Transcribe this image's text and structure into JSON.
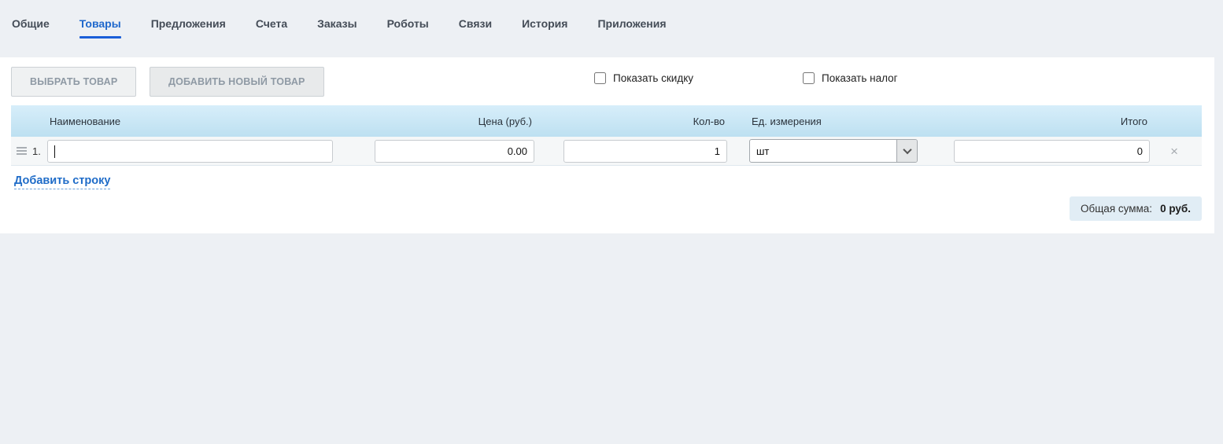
{
  "tabs": [
    {
      "label": "Общие",
      "active": false
    },
    {
      "label": "Товары",
      "active": true
    },
    {
      "label": "Предложения",
      "active": false
    },
    {
      "label": "Счета",
      "active": false
    },
    {
      "label": "Заказы",
      "active": false
    },
    {
      "label": "Роботы",
      "active": false
    },
    {
      "label": "Связи",
      "active": false
    },
    {
      "label": "История",
      "active": false
    },
    {
      "label": "Приложения",
      "active": false
    }
  ],
  "toolbar": {
    "select_product_button": "ВЫБРАТЬ ТОВАР",
    "add_product_button": "ДОБАВИТЬ НОВЫЙ ТОВАР",
    "show_discount_label": "Показать скидку",
    "show_discount_checked": false,
    "show_tax_label": "Показать налог",
    "show_tax_checked": false
  },
  "product_table": {
    "headers": {
      "name": "Наименование",
      "price": "Цена (руб.)",
      "quantity": "Кол-во",
      "unit": "Ед. измерения",
      "total": "Итого"
    },
    "rows": [
      {
        "index": "1.",
        "name_value": "",
        "price_value": "0.00",
        "quantity_value": "1",
        "unit_value": "шт",
        "total_value": "0"
      }
    ],
    "add_row_link": "Добавить строку"
  },
  "summary": {
    "label": "Общая сумма:",
    "value": "0 руб."
  },
  "icons": {
    "drag_handle": "hamburger-lines",
    "chevron_down": "chevron-down",
    "delete_row": "×"
  },
  "colors": {
    "accent_blue": "#1a5ed8",
    "active_tab_text": "#1f68cc",
    "table_header_top": "#d7eefa",
    "table_header_bottom": "#bde0f1",
    "row_background": "#f5f7f8",
    "summary_background": "#e1edf5",
    "page_background": "#edf0f4"
  }
}
